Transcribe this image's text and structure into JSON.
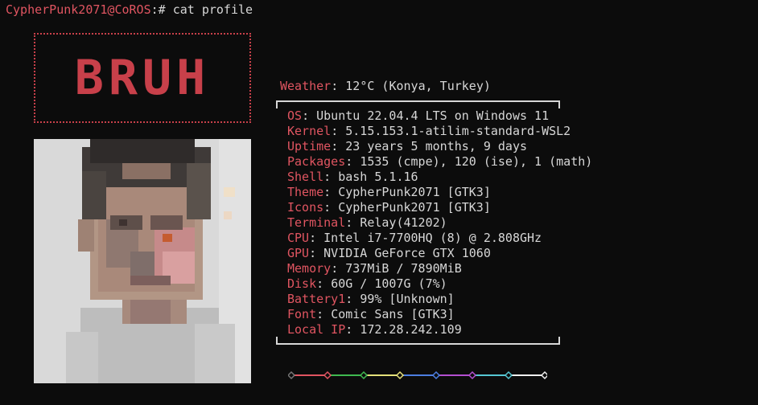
{
  "terminal": {
    "prompt_user": "CypherPunk2071@CoROS",
    "prompt_symbol": ":# ",
    "command": "cat profile"
  },
  "banner": {
    "text": "BRUH",
    "color": "#c8404a"
  },
  "weather": {
    "label": "Weather",
    "value": "12°C (Konya, Turkey)"
  },
  "info": [
    {
      "label": "OS",
      "value": "Ubuntu 22.04.4 LTS on Windows 11"
    },
    {
      "label": "Kernel",
      "value": "5.15.153.1-atilim-standard-WSL2"
    },
    {
      "label": "Uptime",
      "value": "23 years 5 months, 9 days"
    },
    {
      "label": "Packages",
      "value": "1535 (cmpe), 120 (ise), 1 (math)"
    },
    {
      "label": "Shell",
      "value": "bash 5.1.16"
    },
    {
      "label": "Theme",
      "value": "CypherPunk2071 [GTK3]"
    },
    {
      "label": "Icons",
      "value": "CypherPunk2071 [GTK3]"
    },
    {
      "label": "Terminal",
      "value": "Relay(41202)"
    },
    {
      "label": "CPU",
      "value": "Intel i7-7700HQ (8) @ 2.808GHz"
    },
    {
      "label": "GPU",
      "value": "NVIDIA GeForce GTX 1060"
    },
    {
      "label": "Memory",
      "value": "737MiB / 7890MiB"
    },
    {
      "label": "Disk",
      "value": "60G / 1007G (7%)"
    },
    {
      "label": "Battery1",
      "value": "99% [Unknown]"
    },
    {
      "label": "Font",
      "value": "Comic Sans [GTK3]"
    },
    {
      "label": "Local IP",
      "value": "172.28.242.109"
    }
  ],
  "palette": [
    "#767676",
    "#e05561",
    "#3fb950",
    "#e5e07a",
    "#4c7ee0",
    "#b44fd0",
    "#56c7d3",
    "#f0f0f0"
  ],
  "accent_color": "#e05561"
}
